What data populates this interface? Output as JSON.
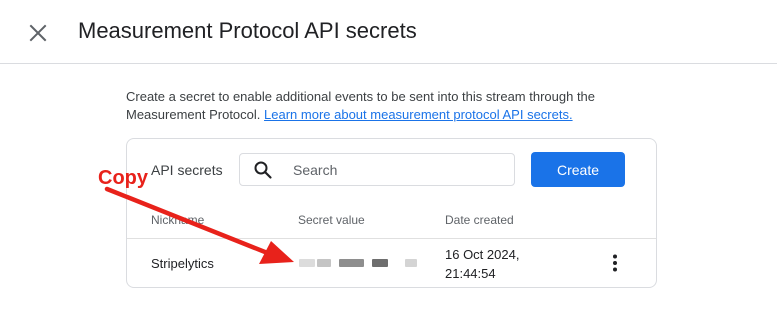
{
  "header": {
    "title": "Measurement Protocol API secrets",
    "close_icon": "close-icon"
  },
  "intro": {
    "text": "Create a secret to enable additional events to be sent into this stream through the Measurement Protocol.",
    "link_label": "Learn more about measurement protocol API secrets."
  },
  "secrets_card": {
    "label": "API secrets",
    "search": {
      "placeholder": "Search",
      "value": "",
      "icon": "search-icon"
    },
    "create_label": "Create",
    "columns": [
      "Nickname",
      "Secret value",
      "Date created"
    ],
    "rows": [
      {
        "nickname": "Stripelytics",
        "secret_value": "",
        "date_line1": "16 Oct 2024,",
        "date_line2": "21:44:54",
        "menu_icon": "more-vert-icon"
      }
    ]
  },
  "annotation": {
    "label": "Copy",
    "color": "#e8221b"
  },
  "colors": {
    "accent": "#1a73e8",
    "border": "#dadce0",
    "annotation": "#e8221b"
  }
}
